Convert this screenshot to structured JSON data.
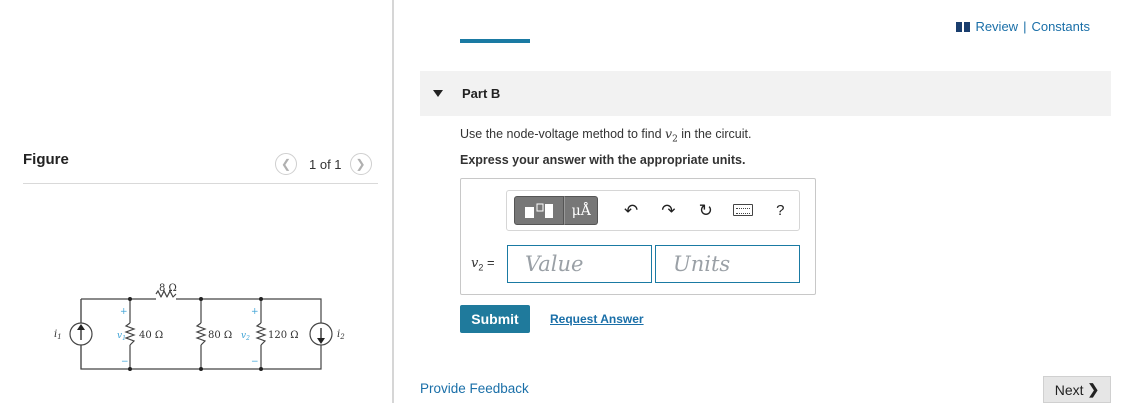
{
  "left": {
    "figure_title": "Figure",
    "pager": {
      "text": "1 of 1",
      "prev_icon": "chevron-left-icon",
      "next_icon": "chevron-right-icon"
    }
  },
  "circuit": {
    "resistor_top": "8 Ω",
    "r1": "40 Ω",
    "r2": "80 Ω",
    "r3": "120 Ω",
    "v1": "v",
    "v1_sub": "1",
    "v2": "v",
    "v2_sub": "2",
    "i1": "i",
    "i1_sub": "1",
    "i2": "i",
    "i2_sub": "2",
    "plus": "+",
    "minus": "−"
  },
  "header": {
    "review": "Review",
    "separator": "|",
    "constants": "Constants"
  },
  "part": {
    "title": "Part B"
  },
  "question": {
    "prefix": "Use the node-voltage method to find ",
    "var": "v",
    "sub": "2",
    "suffix": " in the circuit.",
    "instruction": "Express your answer with the appropriate units."
  },
  "toolbar": {
    "mu": "μÅ",
    "undo": "↶",
    "redo": "↷",
    "reset": "↻",
    "help": "?"
  },
  "answer": {
    "label_var": "v",
    "label_sub": "2",
    "label_eq": " =",
    "value_placeholder": "Value",
    "units_placeholder": "Units"
  },
  "actions": {
    "submit": "Submit",
    "request": "Request Answer",
    "feedback": "Provide Feedback",
    "next": "Next",
    "next_chev": "❯"
  },
  "colors": {
    "accent": "#1f7a9c",
    "link": "#1a6fa8",
    "circuit_plus": "#3fa3d6"
  }
}
